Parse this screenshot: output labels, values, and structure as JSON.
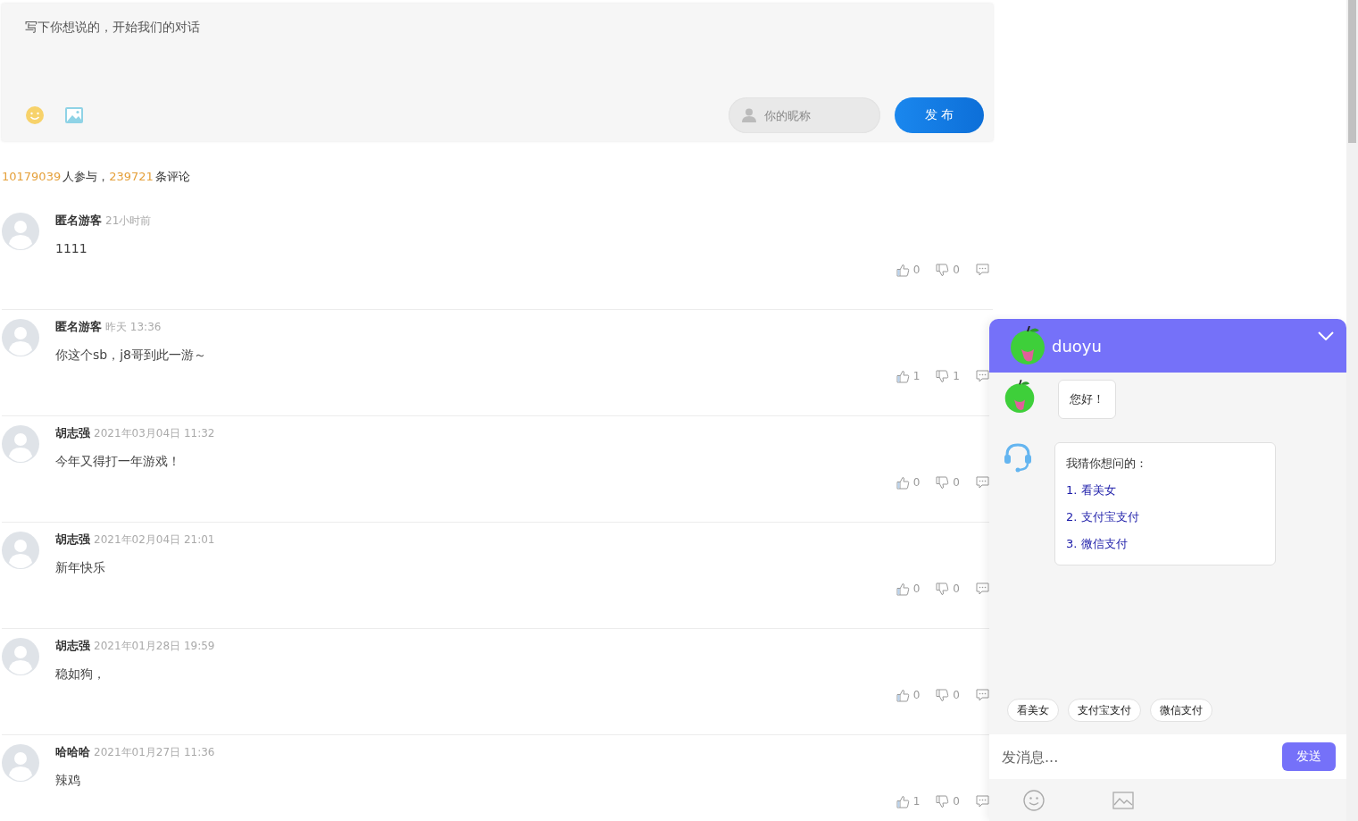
{
  "composer": {
    "placeholder": "写下你想说的，开始我们的对话",
    "nickname_placeholder": "你的昵称",
    "submit": "发 布"
  },
  "stats": {
    "participants": "10179039",
    "participants_label": "人参与，",
    "comments": "239721",
    "comments_label": "条评论"
  },
  "comments": [
    {
      "name": "匿名游客",
      "time": "21小时前",
      "text": "1111",
      "likes": "0",
      "dislikes": "0"
    },
    {
      "name": "匿名游客",
      "time": "昨天 13:36",
      "text": "你这个sb，j8哥到此一游～",
      "likes": "1",
      "dislikes": "1"
    },
    {
      "name": "胡志强",
      "time": "2021年03月04日 11:32",
      "text": "今年又得打一年游戏！",
      "likes": "0",
      "dislikes": "0"
    },
    {
      "name": "胡志强",
      "time": "2021年02月04日 21:01",
      "text": "新年快乐",
      "likes": "0",
      "dislikes": "0"
    },
    {
      "name": "胡志强",
      "time": "2021年01月28日 19:59",
      "text": "稳如狗，",
      "likes": "0",
      "dislikes": "0"
    },
    {
      "name": "哈哈哈",
      "time": "2021年01月27日 11:36",
      "text": "辣鸡",
      "likes": "1",
      "dislikes": "0"
    }
  ],
  "chat": {
    "title": "duoyu",
    "messages": [
      {
        "kind": "text",
        "text": "您好！"
      },
      {
        "kind": "suggestions",
        "intro": "我猜你想问的：",
        "options": [
          "1. 看美女",
          "2. 支付宝支付",
          "3. 微信支付"
        ]
      }
    ],
    "quick_replies": [
      "看美女",
      "支付宝支付",
      "微信支付"
    ],
    "input_placeholder": "发消息...",
    "send": "发送"
  }
}
